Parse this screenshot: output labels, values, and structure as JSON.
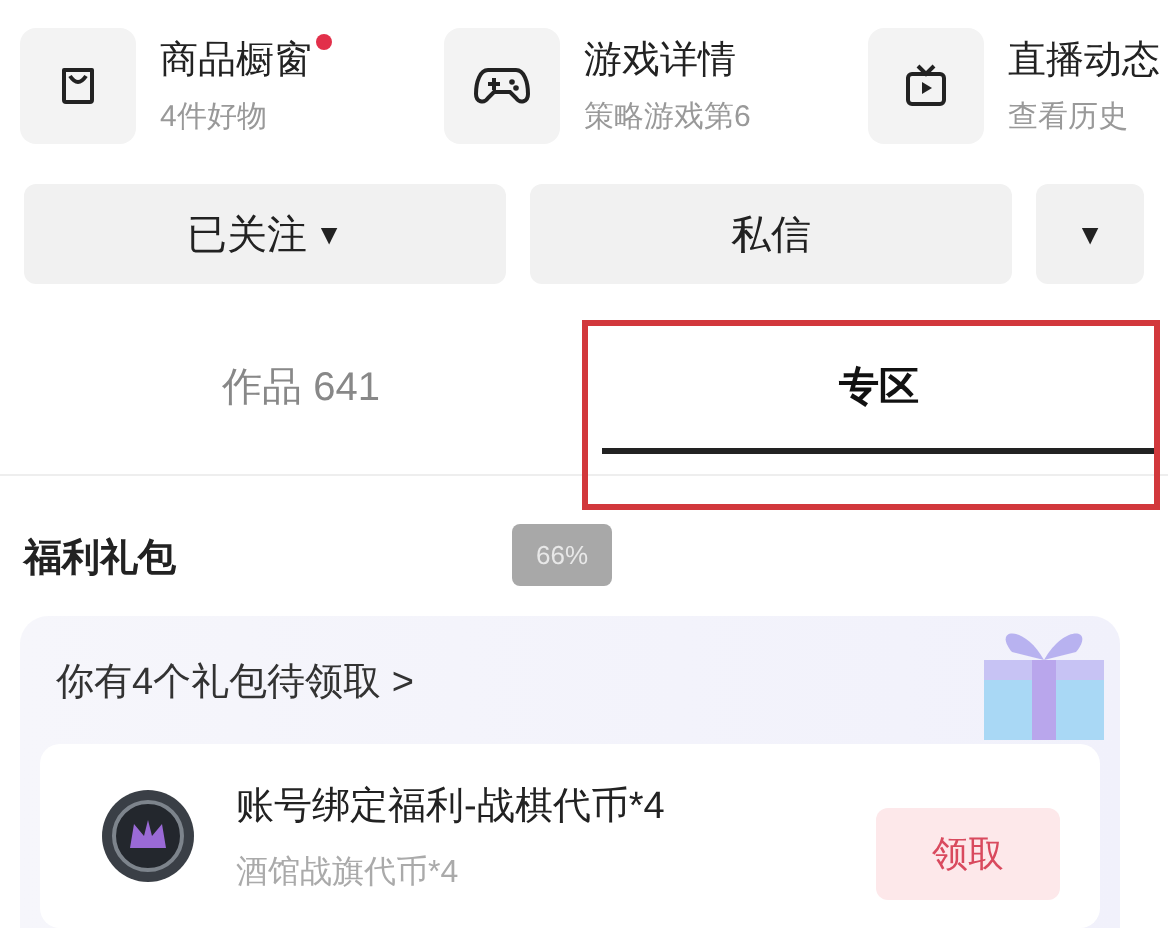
{
  "shortcuts": [
    {
      "kind": "bag",
      "title": "商品橱窗",
      "subtitle": "4件好物",
      "badge": true
    },
    {
      "kind": "gamepad",
      "title": "游戏详情",
      "subtitle": "策略游戏第6",
      "badge": false
    },
    {
      "kind": "tv",
      "title": "直播动态",
      "subtitle": "查看历史",
      "badge": false
    }
  ],
  "actions": [
    {
      "label": "已关注",
      "caret": "▼"
    },
    {
      "label": "私信"
    },
    {
      "caret": "▼"
    }
  ],
  "tabs": [
    {
      "label": "作品 641",
      "selected": false
    },
    {
      "label": "专区",
      "selected": true
    }
  ],
  "section_title": "福利礼包",
  "toast": "66%",
  "gift_card": {
    "header": "你有4个礼包待领取",
    "chevron": ">",
    "items": [
      {
        "title": "账号绑定福利-战棋代币*4",
        "subtitle": "酒馆战旗代币*4",
        "button": "领取"
      }
    ]
  }
}
